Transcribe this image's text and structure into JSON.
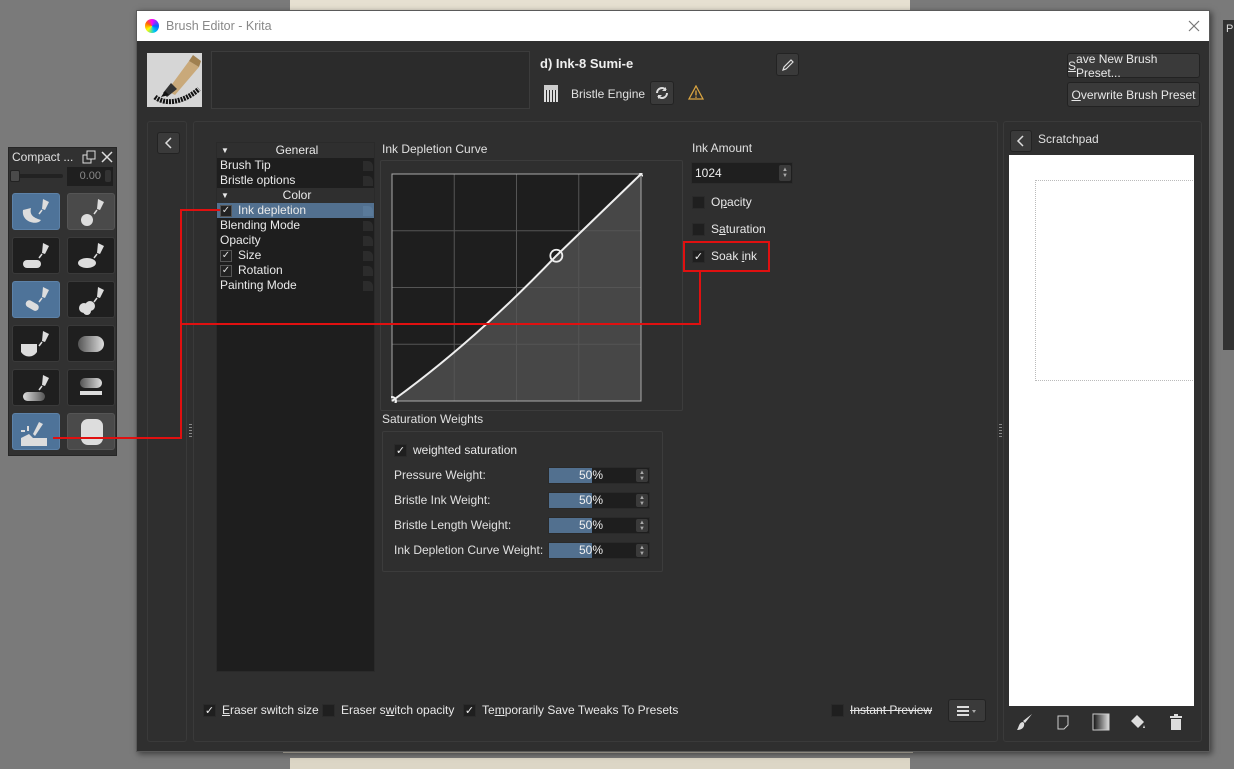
{
  "window": {
    "title": "Brush Editor - Krita",
    "close_label": "✕"
  },
  "preset": {
    "name": "d) Ink-8 Sumi-e",
    "engine": "Bristle Engine",
    "description": ""
  },
  "buttons": {
    "save_new_prefix": "S",
    "save_new_rest": "ave New Brush Preset...",
    "overwrite_prefix": "O",
    "overwrite_rest": "verwrite Brush Preset"
  },
  "compact_docker": {
    "title": "Compact ...",
    "value": "0.00",
    "presets": [
      {
        "name": "brush-preset-1",
        "state": "active"
      },
      {
        "name": "brush-preset-2",
        "state": "highlight"
      },
      {
        "name": "brush-preset-3",
        "state": "normal"
      },
      {
        "name": "brush-preset-4",
        "state": "normal"
      },
      {
        "name": "brush-preset-5",
        "state": "active"
      },
      {
        "name": "brush-preset-6",
        "state": "normal"
      },
      {
        "name": "brush-preset-7",
        "state": "normal"
      },
      {
        "name": "brush-preset-8",
        "state": "normal"
      },
      {
        "name": "brush-preset-9",
        "state": "normal"
      },
      {
        "name": "brush-preset-10",
        "state": "normal"
      },
      {
        "name": "brush-preset-11",
        "state": "active"
      },
      {
        "name": "brush-preset-12",
        "state": "highlight"
      }
    ]
  },
  "options": {
    "items": [
      {
        "label": "General",
        "type": "category"
      },
      {
        "label": "Brush Tip",
        "type": "item"
      },
      {
        "label": "Bristle options",
        "type": "item"
      },
      {
        "label": "Color",
        "type": "category"
      },
      {
        "label": "Ink depletion",
        "type": "checkbox",
        "checked": true,
        "selected": true
      },
      {
        "label": "Blending Mode",
        "type": "item"
      },
      {
        "label": "Opacity",
        "type": "item"
      },
      {
        "label": "Size",
        "type": "checkbox",
        "checked": true
      },
      {
        "label": "Rotation",
        "type": "checkbox",
        "checked": true
      },
      {
        "label": "Painting Mode",
        "type": "item"
      }
    ]
  },
  "ink_depletion": {
    "curve_label": "Ink Depletion Curve",
    "curve_points": [
      [
        0,
        0
      ],
      [
        0.66,
        0.64
      ],
      [
        1,
        1
      ]
    ],
    "ink_amount_label": "Ink Amount",
    "ink_amount_value": "1024",
    "opacity_label_pre": "O",
    "opacity_label_u": "p",
    "opacity_label_post": "acity",
    "opacity_checked": false,
    "saturation_label_pre": "S",
    "saturation_label_u": "a",
    "saturation_label_post": "turation",
    "saturation_checked": false,
    "soak_label_pre": "Soak ",
    "soak_label_u": "i",
    "soak_label_post": "nk",
    "soak_checked": true
  },
  "saturation_weights": {
    "title": "Saturation Weights",
    "weighted_label": "weighted saturation",
    "weighted_checked": true,
    "weights": [
      {
        "label": "Pressure Weight:",
        "value": "50%",
        "fraction": 0.5
      },
      {
        "label": "Bristle Ink Weight:",
        "value": "50%",
        "fraction": 0.5
      },
      {
        "label": "Bristle Length Weight:",
        "value": "50%",
        "fraction": 0.5
      },
      {
        "label": "Ink Depletion Curve Weight:",
        "value": "50%",
        "fraction": 0.5
      }
    ]
  },
  "footer": {
    "eraser_size_u": "E",
    "eraser_size_rest": "raser switch size",
    "eraser_size_checked": true,
    "eraser_opacity_pre": "Eraser s",
    "eraser_opacity_u": "w",
    "eraser_opacity_post": "itch opacity",
    "eraser_opacity_checked": false,
    "temp_save_pre": "Te",
    "temp_save_u": "m",
    "temp_save_post": "porarily Save Tweaks To Presets",
    "temp_save_checked": true,
    "instant_preview": "Instant Preview",
    "instant_preview_checked": false
  },
  "scratchpad": {
    "title": "Scratchpad",
    "tools": [
      "paint-brush-icon",
      "clear-icon",
      "gradient-icon",
      "fill-icon",
      "delete-icon"
    ]
  },
  "right_dock": {
    "label": "P"
  },
  "colors": {
    "accent": "#52708f",
    "highlight_red": "#e01010",
    "background": "#2f2f2f"
  }
}
